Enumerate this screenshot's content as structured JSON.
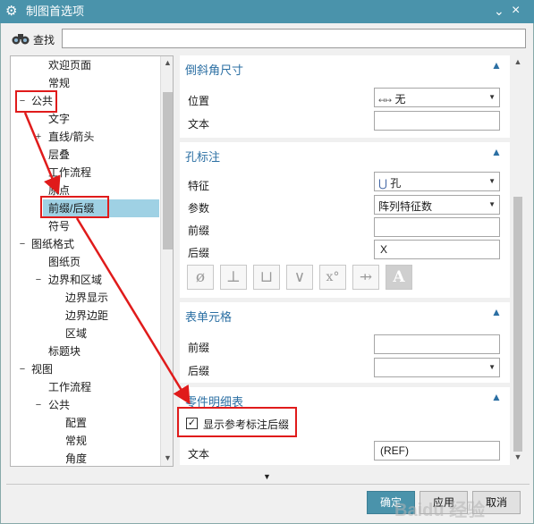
{
  "window": {
    "title": "制图首选项",
    "icons": {
      "settings": "gear-icon",
      "collapse": "chevron-down-icon",
      "close": "close-icon"
    }
  },
  "search": {
    "label": "查找",
    "value": "",
    "placeholder": "",
    "icon": "binoculars-icon"
  },
  "tree": {
    "items": [
      {
        "label": "欢迎页面",
        "toggle": ""
      },
      {
        "label": "常规",
        "toggle": ""
      },
      {
        "label": "公共",
        "toggle": "−"
      },
      {
        "label": "文字",
        "toggle": ""
      },
      {
        "label": "直线/箭头",
        "toggle": "+"
      },
      {
        "label": "层叠",
        "toggle": ""
      },
      {
        "label": "工作流程",
        "toggle": ""
      },
      {
        "label": "原点",
        "toggle": ""
      },
      {
        "label": "前缀/后缀",
        "toggle": "",
        "selected": true
      },
      {
        "label": "符号",
        "toggle": ""
      },
      {
        "label": "图纸格式",
        "toggle": "−"
      },
      {
        "label": "图纸页",
        "toggle": ""
      },
      {
        "label": "边界和区域",
        "toggle": "−"
      },
      {
        "label": "边界显示",
        "toggle": ""
      },
      {
        "label": "边界边距",
        "toggle": ""
      },
      {
        "label": "区域",
        "toggle": ""
      },
      {
        "label": "标题块",
        "toggle": ""
      },
      {
        "label": "视图",
        "toggle": "−"
      },
      {
        "label": "工作流程",
        "toggle": ""
      },
      {
        "label": "公共",
        "toggle": "−"
      },
      {
        "label": "配置",
        "toggle": ""
      },
      {
        "label": "常规",
        "toggle": ""
      },
      {
        "label": "角度",
        "toggle": ""
      }
    ]
  },
  "chamfer": {
    "title": "倒斜角尺寸",
    "position_label": "位置",
    "position_value": "无",
    "position_icon": "dimension-position-icon",
    "text_label": "文本",
    "text_value": ""
  },
  "hole": {
    "title": "孔标注",
    "feature_label": "特征",
    "feature_value": "孔",
    "feature_icon": "hole-feature-icon",
    "param_label": "参数",
    "param_value": "阵列特征数",
    "prefix_label": "前缀",
    "prefix_value": "",
    "suffix_label": "后缀",
    "suffix_value": "X",
    "symbols": [
      "ø",
      "⊥",
      "⊔",
      "∨",
      "x°",
      "⇸",
      "A"
    ]
  },
  "cell": {
    "title": "表单元格",
    "prefix_label": "前缀",
    "prefix_value": "",
    "suffix_label": "后缀",
    "suffix_value": ""
  },
  "parts_list": {
    "title": "零件明细表",
    "checkbox_label": "显示参考标注后缀",
    "checked": true,
    "text_label": "文本",
    "text_value": "(REF)"
  },
  "buttons": {
    "ok": "确定",
    "apply": "应用",
    "cancel": "取消"
  },
  "watermark": "Baidu 经验",
  "colors": {
    "titlebar": "#4a93ab",
    "accent": "#2b6fa3",
    "annotation": "#e01b1b",
    "selection": "#9fd1e4"
  }
}
